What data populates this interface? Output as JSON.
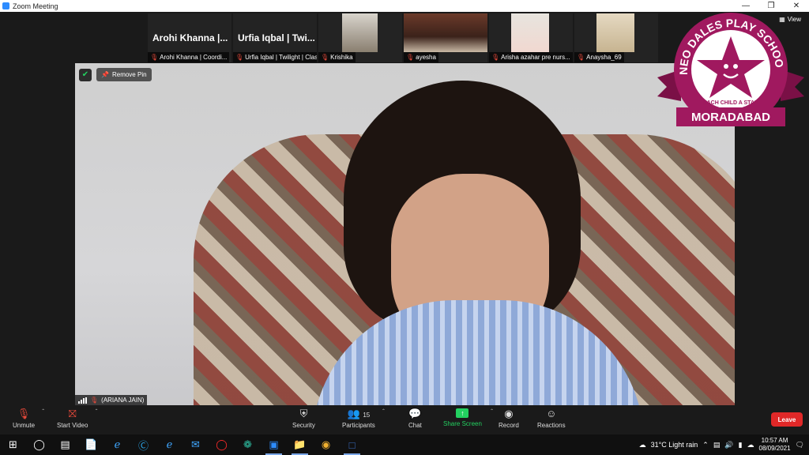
{
  "window": {
    "title": "Zoom Meeting"
  },
  "thumbnails": [
    {
      "big_name": "Arohi Khanna |...",
      "caption": "Arohi Khanna | Coordi..."
    },
    {
      "big_name": "Urfia Iqbal | Twi...",
      "caption": "Urfia Iqbal | Twilight | Clas..."
    },
    {
      "caption": "Krishika"
    },
    {
      "caption": "ayesha"
    },
    {
      "caption": "Arisha azahar pre nurs..."
    },
    {
      "caption": "Anaysha_69"
    }
  ],
  "view_label": "View",
  "main": {
    "remove_pin": "Remove Pin",
    "participant_name": "(ARIANA JAIN)"
  },
  "logo": {
    "top_text": "NEO DALES PLAY SCHOOL",
    "tagline": "EACH CHILD A STAR",
    "bottom_text": "MORADABAD"
  },
  "toolbar": {
    "unmute": "Unmute",
    "start_video": "Start Video",
    "security": "Security",
    "participants": "Participants",
    "participants_count": "15",
    "chat": "Chat",
    "share_screen": "Share Screen",
    "record": "Record",
    "reactions": "Reactions",
    "leave": "Leave"
  },
  "tray": {
    "weather": "31°C  Light rain",
    "time": "10:57 AM",
    "date": "08/09/2021"
  },
  "colors": {
    "accent_green": "#23d160",
    "leave_red": "#e02828",
    "logo_magenta": "#a0195f"
  }
}
